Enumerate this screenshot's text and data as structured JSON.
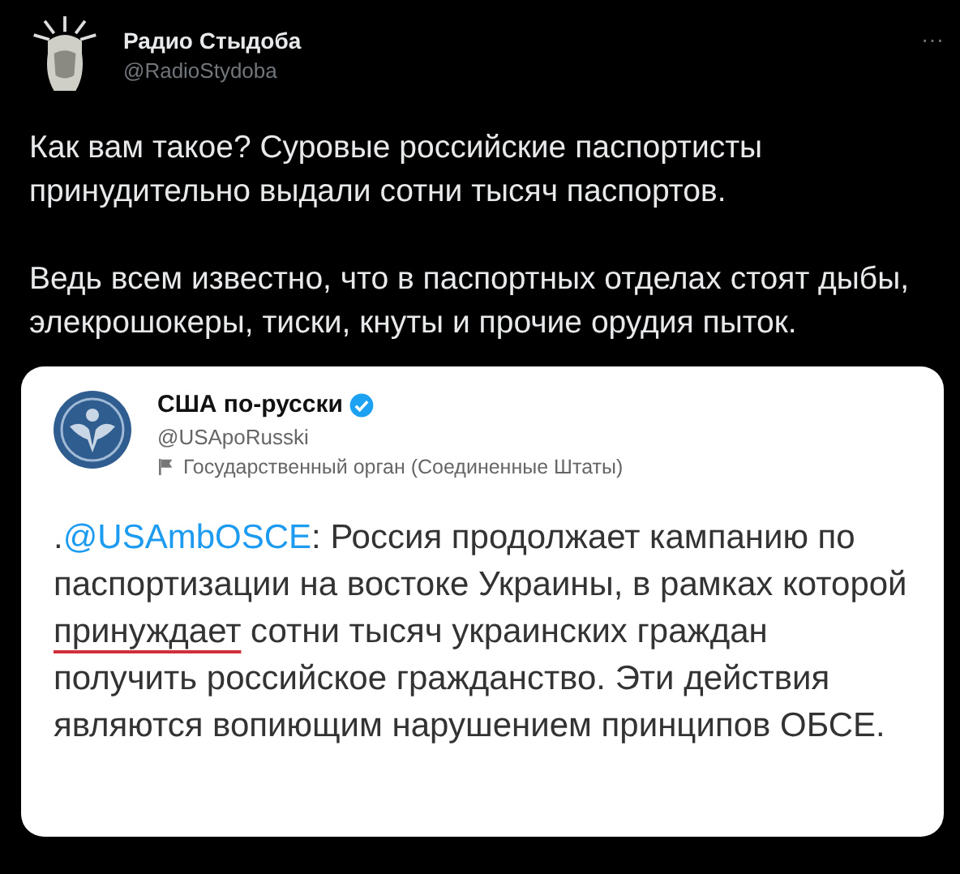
{
  "tweet": {
    "author": {
      "name": "Радио Стыдоба",
      "handle": "@RadioStydoba"
    },
    "more": "···",
    "paragraphs": [
      "Как вам такое? Суровые российские паспортисты принудительно выдали сотни тысяч паспортов.",
      "Ведь всем известно, что в паспортных отделах стоят дыбы, элекрошокеры, тиски, кнуты и прочие орудия пыток."
    ]
  },
  "embedded": {
    "author": {
      "name": "США по-русски",
      "handle": "@USApoRusski",
      "verified": true
    },
    "label": "Государственный орган (Соединенные Штаты)",
    "body": [
      {
        "kind": "text",
        "text": "."
      },
      {
        "kind": "mention",
        "text": "@USAmbOSCE"
      },
      {
        "kind": "text",
        "text": ": Россия продолжает кампанию по паспортизации на востоке Украины, в рамках которой "
      },
      {
        "kind": "underlined",
        "text": "принуждает"
      },
      {
        "kind": "text",
        "text": " сотни тысяч украинских граждан получить российское гражданство. Эти действия являются вопиющим нарушением принципов ОБСЕ."
      }
    ]
  }
}
